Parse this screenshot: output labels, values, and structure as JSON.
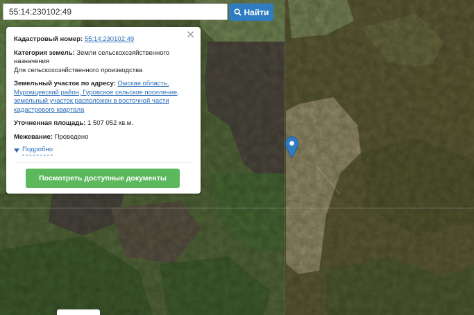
{
  "search": {
    "value": "55:14:230102:49",
    "button_label": "Найти"
  },
  "popup": {
    "cadastral_label": "Кадастровый номер:",
    "cadastral_value": "55:14:230102:49",
    "category_label": "Категория земель:",
    "category_value": "Земли сельскохозяйственного назначения",
    "category_use": "Для сельскохозяйственного производства",
    "address_label": "Земельный участок по адресу:",
    "address_value": "Омская область, Муромцевский район, Гуровское сельское поселение, земельный участок расположен в восточной части кадастрового квартала",
    "area_label": "Уточненная площадь:",
    "area_value": "1 507 052 кв.м.",
    "survey_label": "Межевание:",
    "survey_value": "Проведено",
    "details_link": "Подробно",
    "docs_button": "Посмотреть доступные документы"
  },
  "icons": {
    "search": "search-icon",
    "close": "close-icon",
    "marker": "map-marker-icon",
    "expand": "triangle-down-icon"
  },
  "colors": {
    "search_button": "#2f7cc1",
    "docs_button": "#5cb85c",
    "link": "#2a6fb8",
    "marker": "#2f7cc1"
  }
}
